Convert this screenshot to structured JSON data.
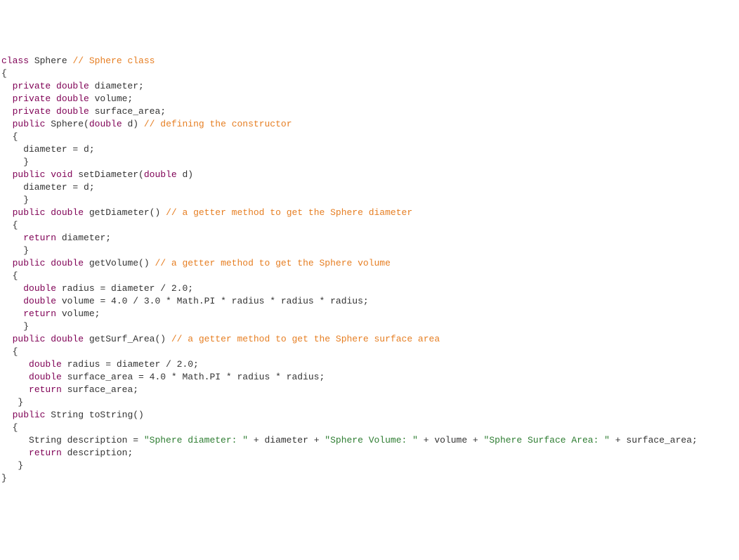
{
  "code": {
    "t01": "class",
    "t02": " Sphere ",
    "t03": "// Sphere class",
    "t04": "{",
    "t05": "  ",
    "t06": "private double",
    "t07": " diameter;",
    "t08": "  ",
    "t09": "private double",
    "t10": " volume;",
    "t11": "  ",
    "t12": "private double",
    "t13": " surface_area;",
    "blank1": "",
    "t14": "  ",
    "t15": "public",
    "t16": " Sphere(",
    "t17": "double",
    "t18": " d) ",
    "t19": "// defining the constructor",
    "t20": "  {",
    "t21": "    diameter = d;",
    "t22": "    }",
    "blank2": "",
    "t23": "  ",
    "t24": "public void",
    "t25": " setDiameter(",
    "t26": "double",
    "t27": " d)",
    "t28": "    diameter = d;",
    "t29": "    }",
    "blank3": "",
    "t30": "  ",
    "t31": "public double",
    "t32": " getDiameter() ",
    "t33": "// a getter method to get the Sphere diameter",
    "t34": "  {",
    "t35": "    ",
    "t36": "return",
    "t37": " diameter;",
    "t38": "    }",
    "blank4": "",
    "t39": "  ",
    "t40": "public double",
    "t41": " getVolume() ",
    "t42": "// a getter method to get the Sphere volume",
    "t43": "  {",
    "t44": "    ",
    "t45": "double",
    "t46": " radius = diameter / 2.0;",
    "t47": "    ",
    "t48": "double",
    "t49": " volume = 4.0 / 3.0 * Math.PI * radius * radius * radius;",
    "t50": "    ",
    "t51": "return",
    "t52": " volume;",
    "t53": "    }",
    "blank5": "",
    "t54": "  ",
    "t55": "public double",
    "t56": " getSurf_Area() ",
    "t57": "// a getter method to get the Sphere surface area",
    "t58": "  {",
    "t59": "     ",
    "t60": "double",
    "t61": " radius = diameter / 2.0;",
    "t62": "     ",
    "t63": "double",
    "t64": " surface_area = 4.0 * Math.PI * radius * radius;",
    "t65": "     ",
    "t66": "return",
    "t67": " surface_area;",
    "t68": "   }",
    "blank6": "",
    "t69": "  ",
    "t70": "public",
    "t71": " String toString()",
    "t72": "  {",
    "t73": "     String description = ",
    "t74": "\"Sphere diameter: \"",
    "t75": " + diameter + ",
    "t76": "\"Sphere Volume: \"",
    "t77": " + volume + ",
    "t78": "\"Sphere Surface Area: \"",
    "t79": " + surface_area;",
    "t80": "     ",
    "t81": "return",
    "t82": " description;",
    "t83": "   }",
    "blank7": "",
    "t84": "}"
  }
}
